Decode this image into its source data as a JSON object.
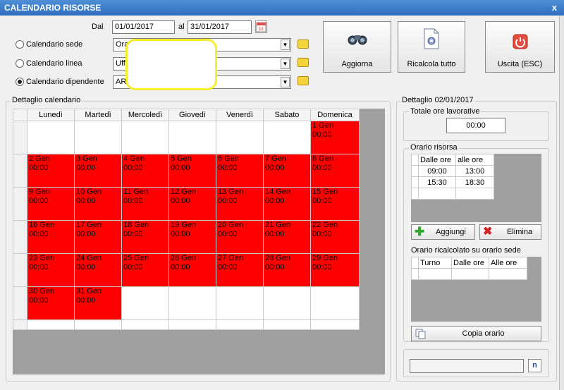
{
  "window": {
    "title": "CALENDARIO RISORSE",
    "close_glyph": "x"
  },
  "filters": {
    "dal_label": "Dal",
    "dal_value": "01/01/2017",
    "al_label": "al",
    "al_value": "31/01/2017",
    "options": [
      {
        "label": "Calendario sede",
        "value": "Ora",
        "selected": false
      },
      {
        "label": "Calendario linea",
        "value": "Uff",
        "selected": false
      },
      {
        "label": "Calendario dipendente",
        "value": "AR",
        "selected": true
      }
    ]
  },
  "buttons": {
    "aggiorna": "Aggiorna",
    "ricalcola": "Ricalcola tutto",
    "uscita": "Uscita (ESC)"
  },
  "calendar": {
    "title": "Dettaglio calendario",
    "days": [
      "Lunedì",
      "Martedì",
      "Mercoledì",
      "Giovedì",
      "Venerdì",
      "Sabato",
      "Domenica"
    ],
    "weeks": [
      [
        null,
        null,
        null,
        null,
        null,
        null,
        {
          "date": "1 Gen",
          "hours": "00:00"
        }
      ],
      [
        {
          "date": "2 Gen",
          "hours": "00:00"
        },
        {
          "date": "3 Gen",
          "hours": "00:00"
        },
        {
          "date": "4 Gen",
          "hours": "00:00"
        },
        {
          "date": "5 Gen",
          "hours": "00:00"
        },
        {
          "date": "6 Gen",
          "hours": "00:00"
        },
        {
          "date": "7 Gen",
          "hours": "00:00"
        },
        {
          "date": "8 Gen",
          "hours": "00:00"
        }
      ],
      [
        {
          "date": "9 Gen",
          "hours": "00:00"
        },
        {
          "date": "10 Gen",
          "hours": "00:00"
        },
        {
          "date": "11 Gen",
          "hours": "00:00"
        },
        {
          "date": "12 Gen",
          "hours": "00:00"
        },
        {
          "date": "13 Gen",
          "hours": "00:00"
        },
        {
          "date": "14 Gen",
          "hours": "00:00"
        },
        {
          "date": "15 Gen",
          "hours": "00:00"
        }
      ],
      [
        {
          "date": "16 Gen",
          "hours": "00:00"
        },
        {
          "date": "17 Gen",
          "hours": "00:00"
        },
        {
          "date": "18 Gen",
          "hours": "00:00"
        },
        {
          "date": "19 Gen",
          "hours": "00:00"
        },
        {
          "date": "20 Gen",
          "hours": "00:00"
        },
        {
          "date": "21 Gen",
          "hours": "00:00"
        },
        {
          "date": "22 Gen",
          "hours": "00:00"
        }
      ],
      [
        {
          "date": "23 Gen",
          "hours": "00:00"
        },
        {
          "date": "24 Gen",
          "hours": "00:00"
        },
        {
          "date": "25 Gen",
          "hours": "00:00"
        },
        {
          "date": "26 Gen",
          "hours": "00:00"
        },
        {
          "date": "27 Gen",
          "hours": "00:00"
        },
        {
          "date": "28 Gen",
          "hours": "00:00"
        },
        {
          "date": "29 Gen",
          "hours": "00:00"
        }
      ],
      [
        {
          "date": "30 Gen",
          "hours": "00:00"
        },
        {
          "date": "31 Gen",
          "hours": "00:00"
        },
        null,
        null,
        null,
        null,
        null
      ]
    ]
  },
  "detail": {
    "title": "Dettaglio 02/01/2017",
    "totale_label": "Totale ore lavorative",
    "totale_value": "00:00",
    "orario_risorsa_label": "Orario risorsa",
    "orario_headers": [
      "Dalle ore",
      "alle ore"
    ],
    "orario_rows": [
      [
        "09:00",
        "13:00"
      ],
      [
        "15:30",
        "18:30"
      ]
    ],
    "aggiungi": "Aggiungi",
    "elimina": "Elimina",
    "ricalcolato_label": "Orario ricalcolato su orario sede",
    "ricalcolato_headers": [
      "Turno",
      "Dalle ore",
      "Alle ore"
    ],
    "copia": "Copia orario"
  },
  "colors": {
    "non_working_day": "#ff0000",
    "highlight": "#f6ee2a",
    "titlebar": "#3a7dcc"
  }
}
